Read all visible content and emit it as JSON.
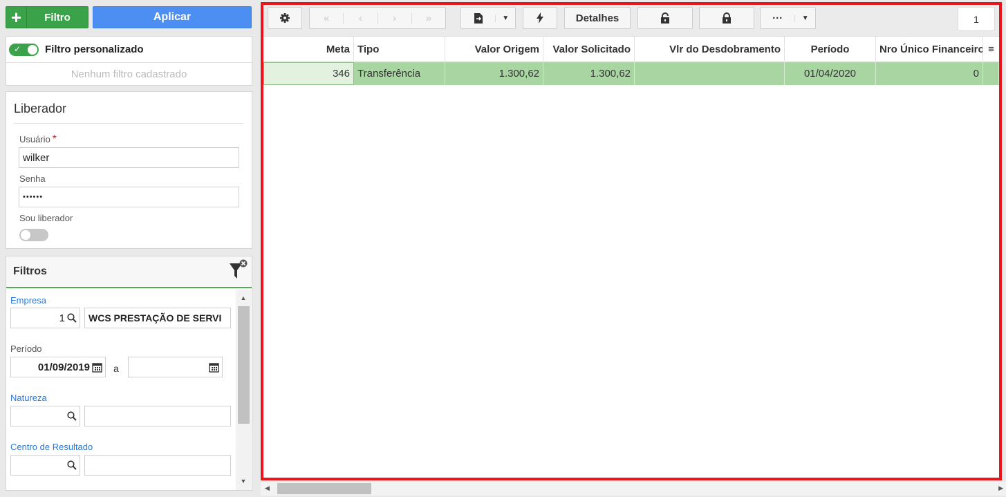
{
  "top_buttons": {
    "filtro_label": "Filtro",
    "aplicar_label": "Aplicar"
  },
  "filtro_personalizado": {
    "label": "Filtro personalizado",
    "enabled": true,
    "empty_text": "Nenhum filtro cadastrado"
  },
  "liberador": {
    "title": "Liberador",
    "usuario_label": "Usuário",
    "required_mark": "*",
    "usuario_value": "wilker",
    "senha_label": "Senha",
    "senha_value": "••••••",
    "sou_liberador_label": "Sou liberador",
    "sou_liberador_enabled": false
  },
  "filtros": {
    "title": "Filtros",
    "empresa_label": "Empresa",
    "empresa_code": "1",
    "empresa_name": "WCS PRESTAÇÃO DE SERVI",
    "periodo_label": "Período",
    "periodo_from": "01/09/2019",
    "periodo_sep": "a",
    "periodo_to": "",
    "natureza_label": "Natureza",
    "natureza_code": "",
    "natureza_name": "",
    "centro_label": "Centro de Resultado",
    "centro_code": "",
    "centro_name": ""
  },
  "toolbar": {
    "detalhes_label": "Detalhes",
    "more_label": "···",
    "page_number": "1",
    "icons": [
      "gear-icon",
      "first-page-icon",
      "prev-page-icon",
      "next-page-icon",
      "last-page-icon",
      "export-icon",
      "dropdown-icon",
      "lightning-icon",
      "unlock-icon",
      "lock-icon",
      "more-icon",
      "dropdown-icon"
    ]
  },
  "grid": {
    "columns": [
      "Meta",
      "Tipo",
      "Valor Origem",
      "Valor Solicitado",
      "Vlr do Desdobramento",
      "Período",
      "Nro Único Financeiro"
    ],
    "rows": [
      [
        "346",
        "Transferência",
        "1.300,62",
        "1.300,62",
        "",
        "01/04/2020",
        "0"
      ]
    ]
  },
  "colors": {
    "green": "#3aa34a",
    "blue": "#4c8ef2",
    "row_highlight": "#a8d5a2",
    "panel_border": "#e8151b"
  }
}
